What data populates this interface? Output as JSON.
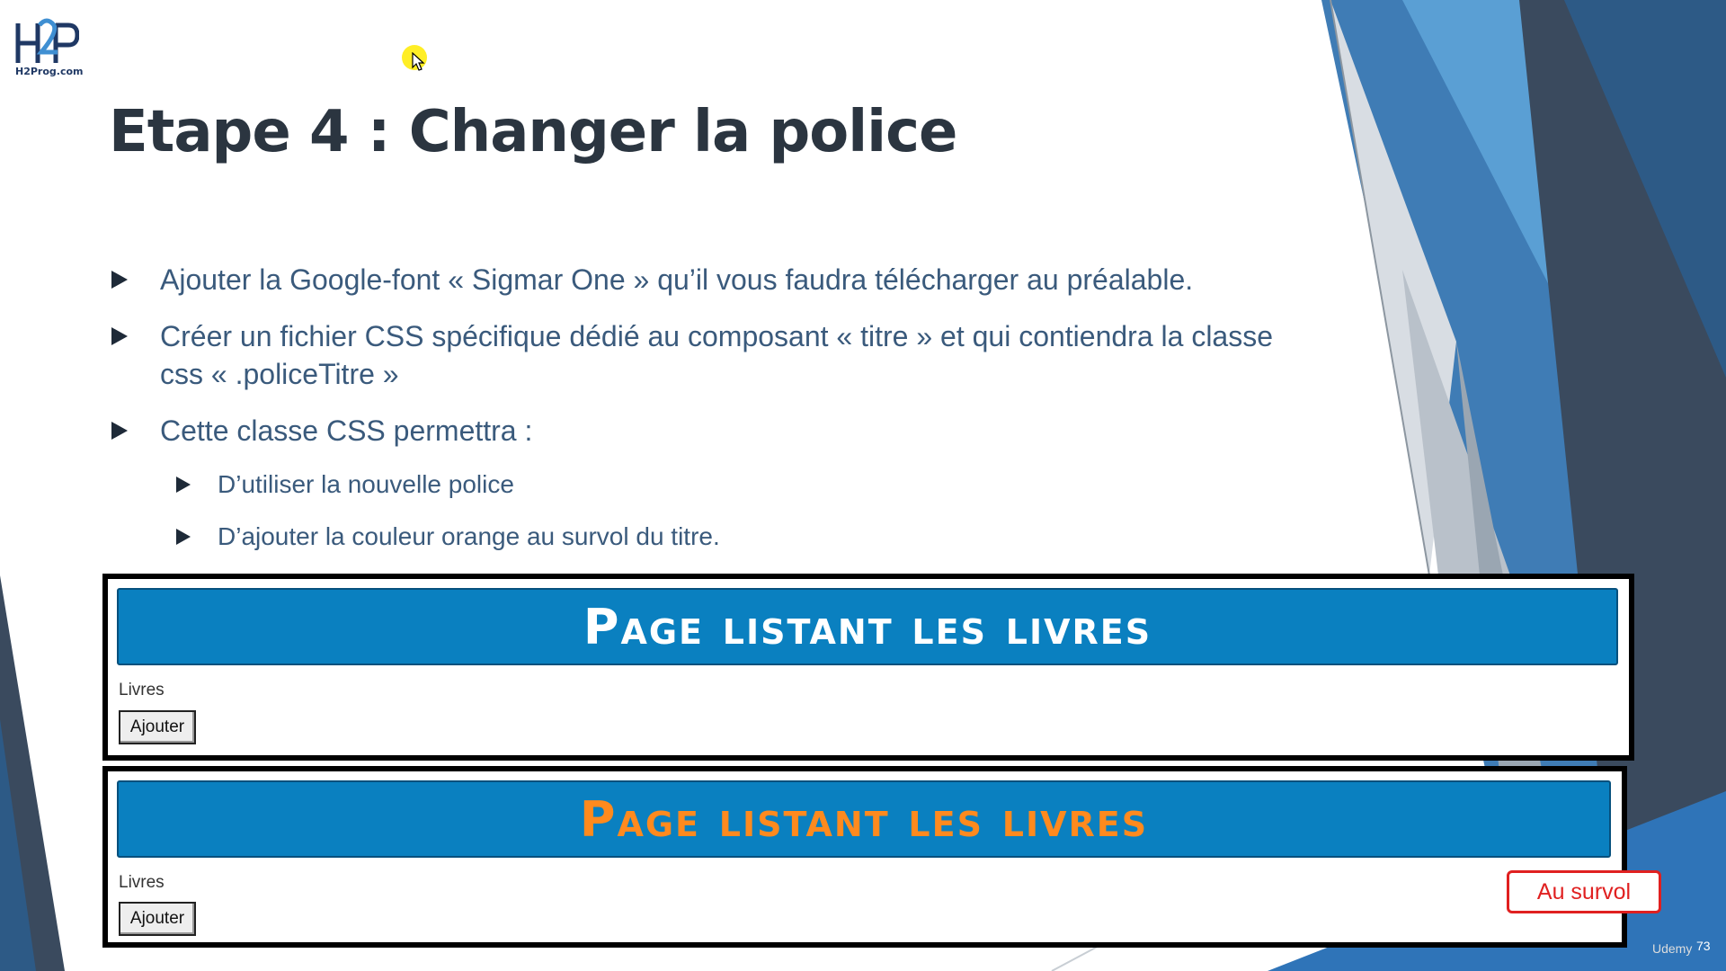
{
  "logo": {
    "caption": "H2Prog.com"
  },
  "slide": {
    "title": "Etape 4 : Changer la police",
    "bullets": [
      "Ajouter la Google-font « Sigmar One » qu’il vous faudra télécharger au préalable.",
      "Créer un fichier CSS spécifique dédié au composant « titre » et qui contiendra la classe css « .policeTitre »",
      "Cette classe CSS permettra :"
    ],
    "sub_bullets": [
      "D’utiliser la nouvelle police",
      "D’ajouter la couleur orange au survol du titre."
    ]
  },
  "demo_normal": {
    "banner": "Page listant les livres",
    "label": "Livres",
    "button": "Ajouter"
  },
  "demo_hover": {
    "banner": "Page listant les livres",
    "label": "Livres",
    "button": "Ajouter",
    "callout": "Au survol"
  },
  "footer": {
    "page_number": "73",
    "watermark": "Udemy"
  },
  "colors": {
    "banner_blue": "#0a80c0",
    "hover_orange": "#ff8a1e",
    "title": "#2b3540",
    "text": "#3a5a7c",
    "callout_red": "#e02020"
  }
}
